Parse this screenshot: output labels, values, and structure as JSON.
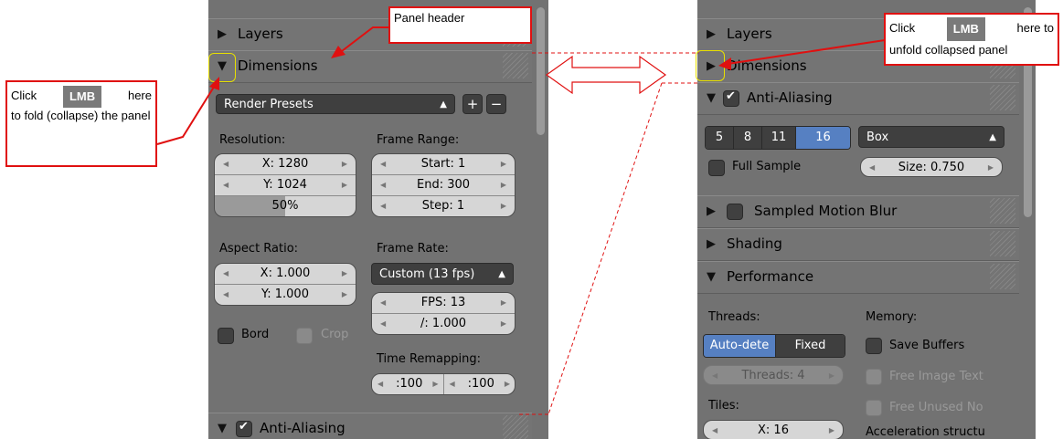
{
  "left": {
    "layers": "Layers",
    "dimensions": "Dimensions",
    "render_presets": "Render Presets",
    "resolution_label": "Resolution:",
    "res_x": "X: 1280",
    "res_y": "Y: 1024",
    "res_pct": "50%",
    "res_pct_fill": 0.5,
    "frame_range_label": "Frame Range:",
    "start": "Start: 1",
    "end": "End: 300",
    "step": "Step: 1",
    "aspect_label": "Aspect Ratio:",
    "aspect_x": "X: 1.000",
    "aspect_y": "Y: 1.000",
    "frame_rate_label": "Frame Rate:",
    "frame_rate": "Custom (13 fps)",
    "fps": "FPS: 13",
    "fps_base": "/: 1.000",
    "bord": "Bord",
    "crop": "Crop",
    "time_remap_label": "Time Remapping:",
    "remap_old": "100",
    "remap_new": "100",
    "anti_aliasing": "Anti-Aliasing"
  },
  "right": {
    "layers": "Layers",
    "dimensions": "Dimensions",
    "anti_aliasing": "Anti-Aliasing",
    "samples": [
      "5",
      "8",
      "11",
      "16"
    ],
    "samples_selected": "16",
    "filter": "Box",
    "full_sample": "Full Sample",
    "size": "Size: 0.750",
    "motion_blur": "Sampled Motion Blur",
    "shading": "Shading",
    "performance": "Performance",
    "threads_label": "Threads:",
    "auto_detect": "Auto-dete",
    "fixed": "Fixed",
    "threads": "Threads: 4",
    "memory_label": "Memory:",
    "save_buffers": "Save Buffers",
    "free_image": "Free Image Text",
    "free_unused": "Free Unused No",
    "tiles_label": "Tiles:",
    "tiles_x": "X: 16",
    "accel": "Acceleration structu"
  },
  "callouts": {
    "panel_header": "Panel header",
    "fold_click": "Click",
    "fold_lmb": "LMB",
    "fold_here": "here",
    "fold_rest": "to fold (collapse) the panel",
    "unfold_click": "Click",
    "unfold_lmb": "LMB",
    "unfold_here": "here to",
    "unfold_rest": "unfold collapsed panel"
  },
  "colors": {
    "annotation_red": "#e01010",
    "highlight_yellow": "#e8e000",
    "selected_blue": "#5680c2"
  }
}
